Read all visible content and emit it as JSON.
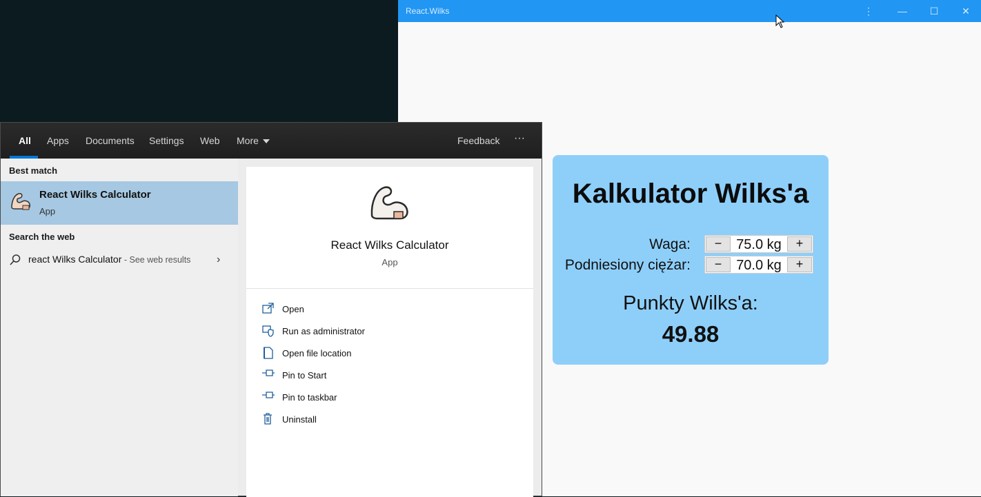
{
  "app_window": {
    "title": "React.Wilks",
    "controls": {
      "menu_glyph": "⋮",
      "minimize_glyph": "—",
      "maximize_glyph": "☐",
      "close_glyph": "✕"
    },
    "card": {
      "heading": "Kalkulator Wilks'a",
      "weight": {
        "label": "Waga:",
        "value": "75.0 kg",
        "minus": "−",
        "plus": "+"
      },
      "lifted": {
        "label": "Podniesiony ciężar:",
        "value": "70.0 kg",
        "minus": "−",
        "plus": "+"
      },
      "result_label": "Punkty Wilks'a:",
      "result_value": "49.88"
    },
    "colors": {
      "titlebar": "#2196f3",
      "card": "#8ecffa"
    }
  },
  "search_panel": {
    "tabs": [
      {
        "label": "All",
        "active": true
      },
      {
        "label": "Apps"
      },
      {
        "label": "Documents"
      },
      {
        "label": "Settings"
      },
      {
        "label": "Web"
      },
      {
        "label": "More"
      }
    ],
    "feedback_label": "Feedback",
    "overflow_glyph": "···",
    "best_match_heading": "Best match",
    "best_match": {
      "name": "React Wilks Calculator",
      "type": "App",
      "icon": "flexed-arm-icon"
    },
    "search_web_heading": "Search the web",
    "web_query": "react Wilks Calculator",
    "web_hint": " - See web results",
    "detail": {
      "name": "React Wilks Calculator",
      "type": "App",
      "actions": [
        {
          "label": "Open",
          "icon": "open-icon"
        },
        {
          "label": "Run as administrator",
          "icon": "shield-icon"
        },
        {
          "label": "Open file location",
          "icon": "file-location-icon"
        },
        {
          "label": "Pin to Start",
          "icon": "pin-icon"
        },
        {
          "label": "Pin to taskbar",
          "icon": "pin-icon"
        },
        {
          "label": "Uninstall",
          "icon": "trash-icon"
        }
      ]
    },
    "colors": {
      "highlight": "#a6c8e2",
      "accent": "#0078d7"
    }
  }
}
